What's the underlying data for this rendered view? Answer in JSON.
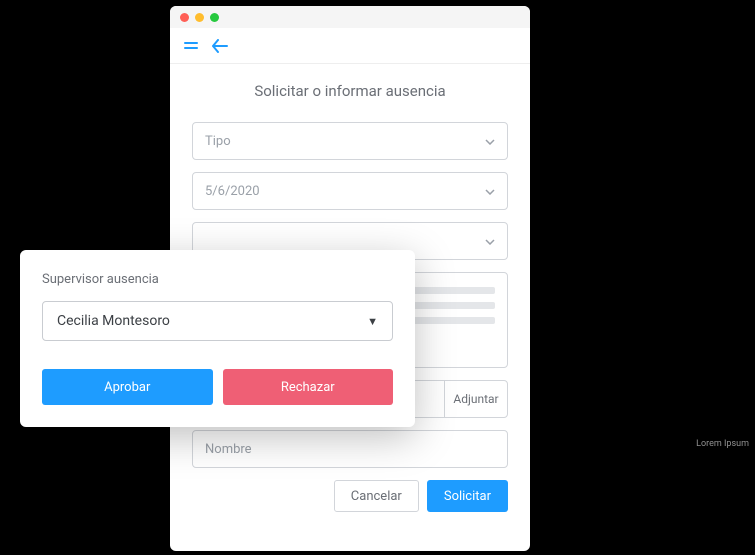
{
  "page": {
    "title": "Solicitar o informar ausencia"
  },
  "fields": {
    "type_placeholder": "Tipo",
    "date_value": "5/6/2020",
    "name_placeholder": "Nombre"
  },
  "buttons": {
    "attach": "Adjuntar",
    "cancel": "Cancelar",
    "submit": "Solicitar"
  },
  "modal": {
    "label": "Supervisor ausencia",
    "selected": "Cecilia Montesoro",
    "approve": "Aprobar",
    "reject": "Rechazar"
  },
  "footer": "Lorem Ipsum"
}
